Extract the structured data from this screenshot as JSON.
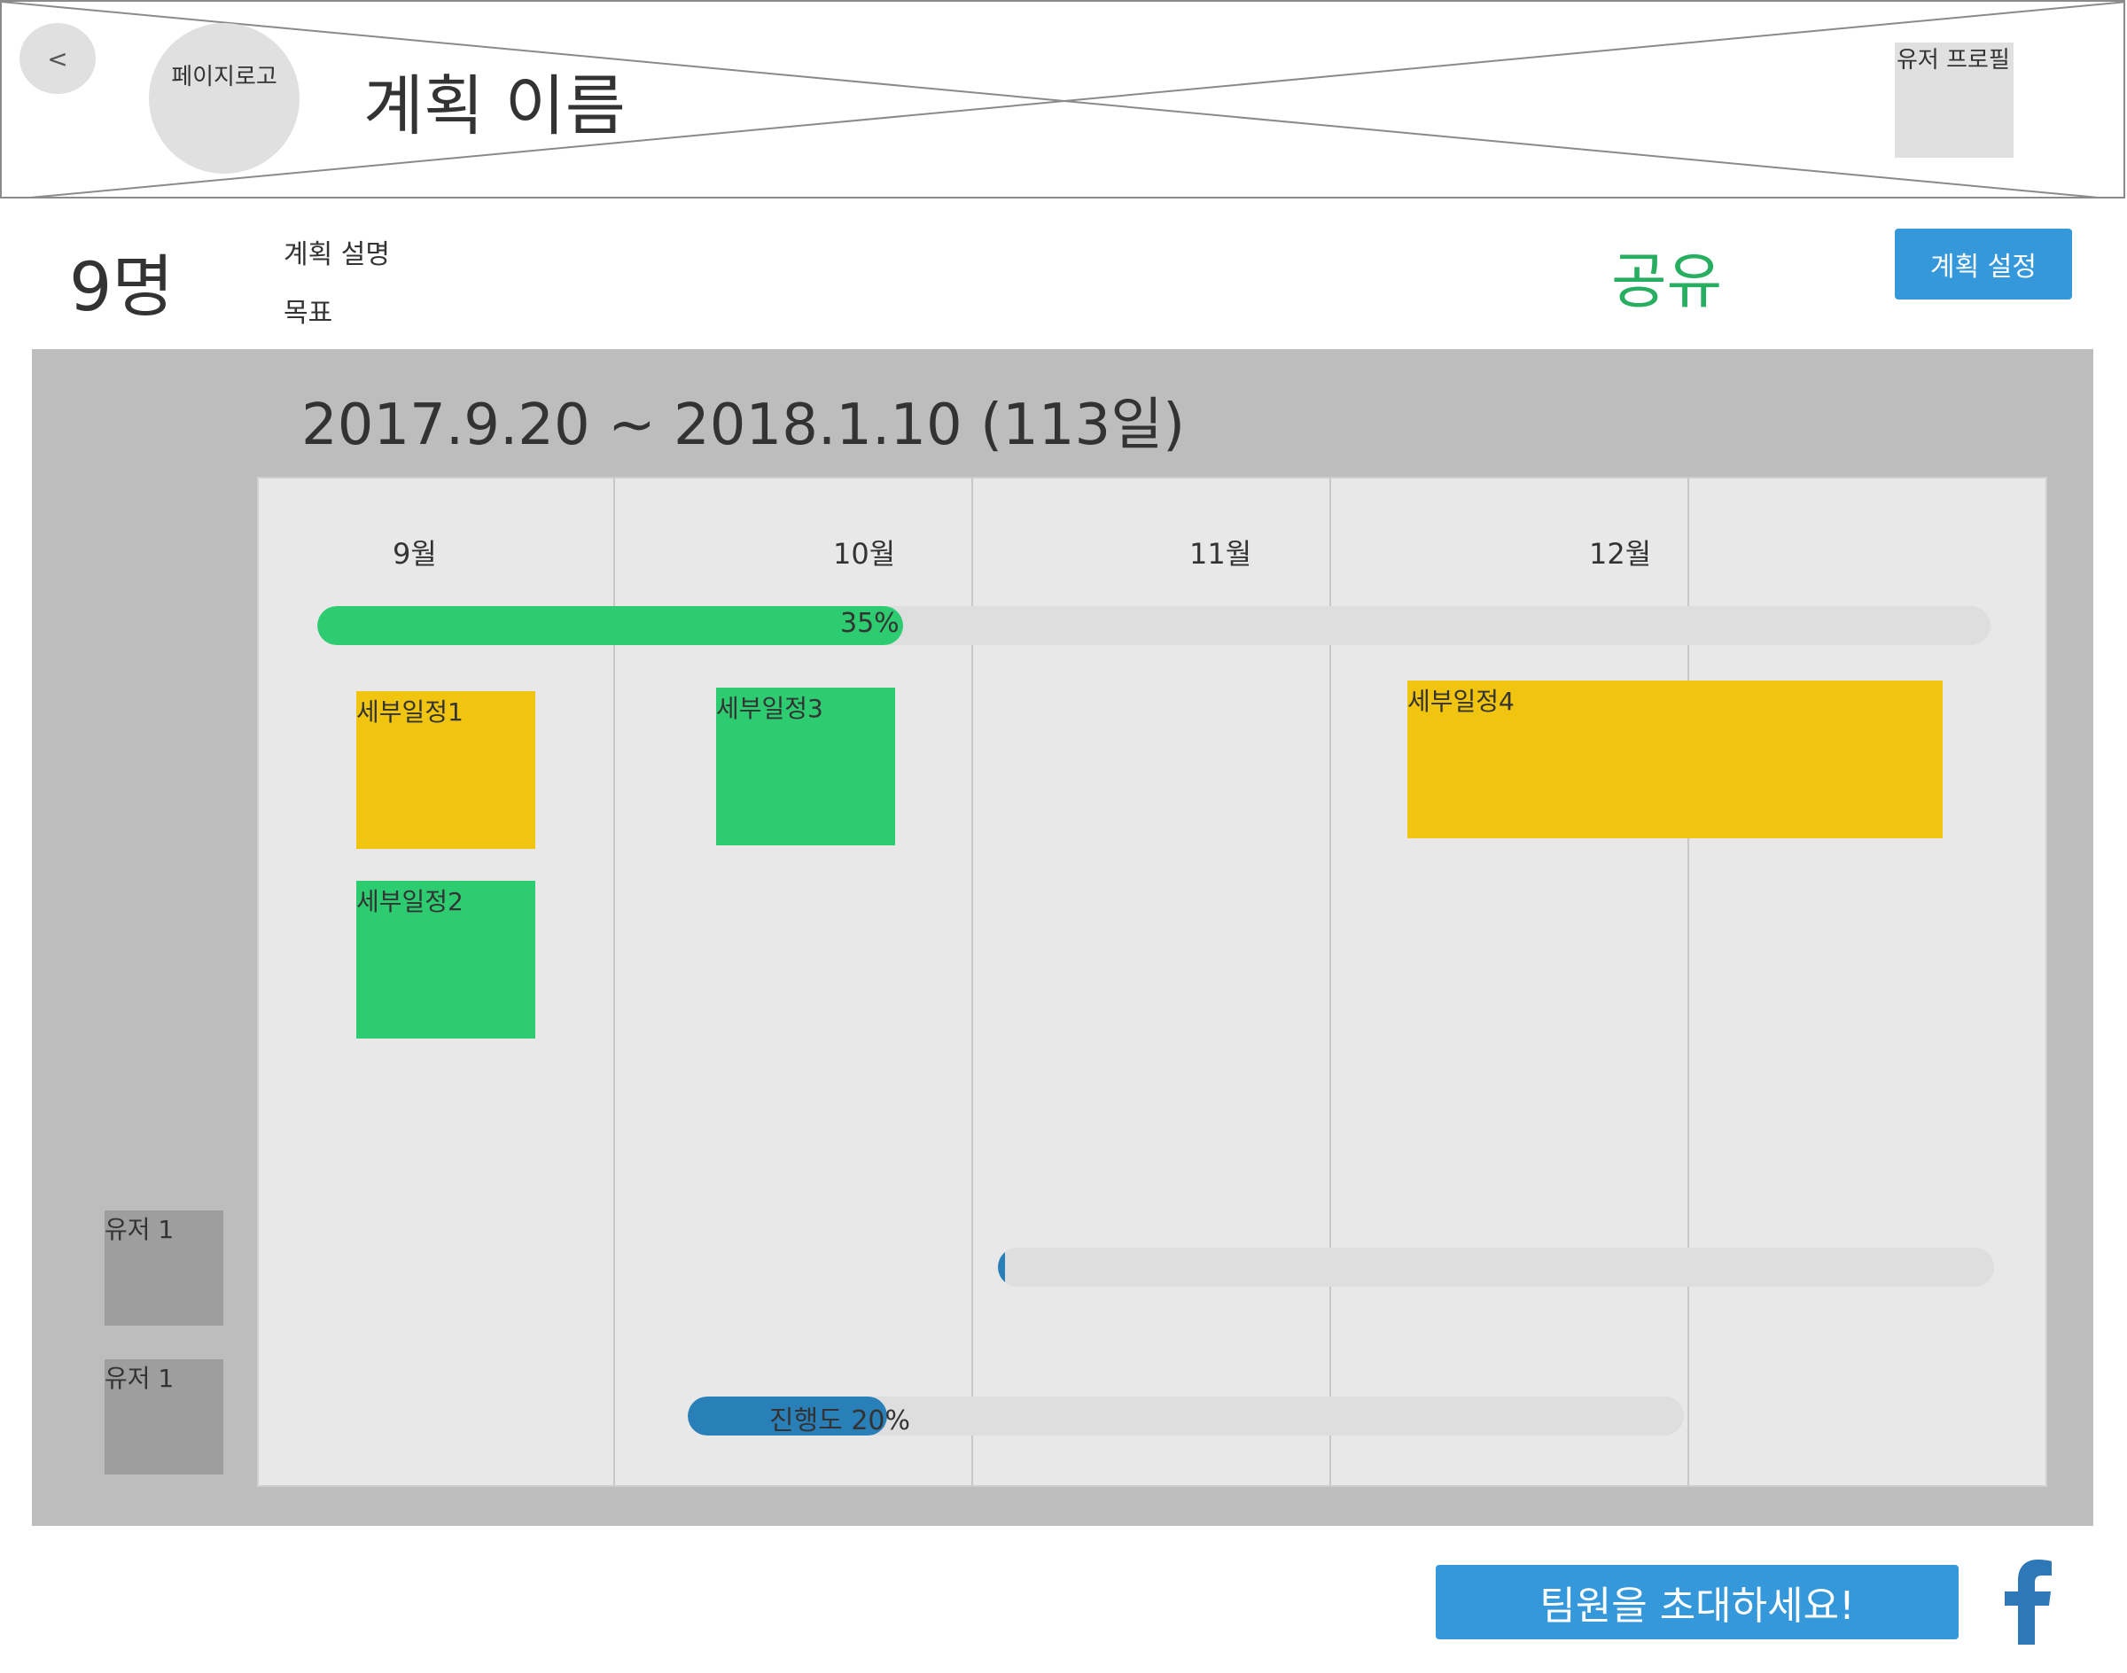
{
  "header": {
    "back_label": "<",
    "logo_label": "페이지로고",
    "plan_title": "계획 이름",
    "profile_label": "유저 프로필"
  },
  "info": {
    "member_count": "9명",
    "description": "계획 설명",
    "goal": "목표",
    "share_label": "공유",
    "settings_label": "계획 설정"
  },
  "timeline": {
    "date_range": "2017.9.20 ~ 2018.1.10 (113일)",
    "months": [
      "9월",
      "10월",
      "11월",
      "12월"
    ],
    "overall_progress": {
      "label": "35%",
      "value": 0.35
    },
    "tasks": [
      {
        "label": "세부일정1",
        "color": "#f1c40f"
      },
      {
        "label": "세부일정3",
        "color": "#2ecc71"
      },
      {
        "label": "세부일정4",
        "color": "#f1c40f"
      },
      {
        "label": "세부일정2",
        "color": "#2ecc71"
      }
    ],
    "users": [
      {
        "label": "유저 1",
        "progress_label": "",
        "progress": 0.005
      },
      {
        "label": "유저 1",
        "progress_label": "진행도 20%",
        "progress": 0.2
      }
    ]
  },
  "footer": {
    "invite_label": "팀원을 초대하세요!",
    "social_icon": "facebook-icon"
  },
  "colors": {
    "accent_blue": "#3498db",
    "progress_green": "#2ecc71",
    "task_yellow": "#f1c40f",
    "user_progress_blue": "#2980b9",
    "share_green": "#27ae60"
  }
}
